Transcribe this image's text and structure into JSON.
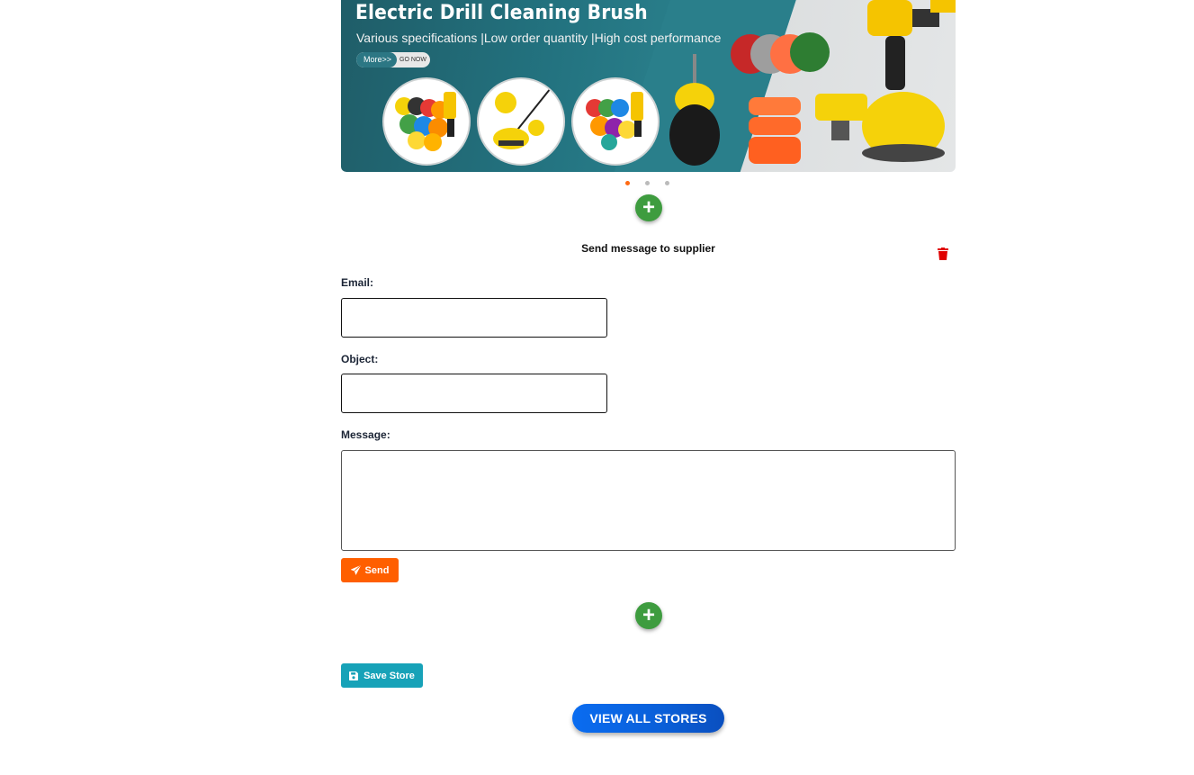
{
  "banner": {
    "title": "Electric Drill Cleaning Brush",
    "subtitle": "Various specifications |Low order quantity |High cost performance",
    "more_label": "More>>",
    "go_now_label": "GO NOW"
  },
  "carousel": {
    "slide_count": 3,
    "active_index": 0,
    "active_color": "#ff6a13",
    "inactive_color": "#bbbbbb"
  },
  "form": {
    "title": "Send message to supplier",
    "email_label": "Email:",
    "email_value": "",
    "object_label": "Object:",
    "object_value": "",
    "message_label": "Message:",
    "message_value": "",
    "send_label": "Send",
    "delete_icon": "trash-icon"
  },
  "actions": {
    "add_icon": "plus-icon",
    "save_store_label": "Save Store",
    "view_all_label": "VIEW ALL STORES"
  },
  "colors": {
    "add_green": "#3e9c3f",
    "send_orange": "#ff5f00",
    "save_teal": "#17a2b8",
    "view_all_blue": "#0a6cf0",
    "delete_red": "#e00000"
  }
}
